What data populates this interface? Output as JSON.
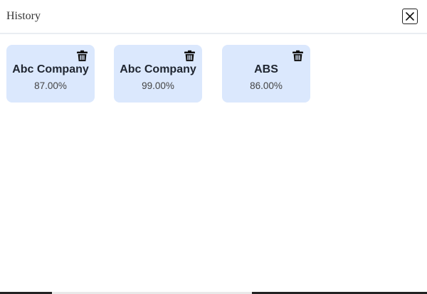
{
  "header": {
    "title": "History"
  },
  "history": {
    "items": [
      {
        "name": "Abc Company",
        "score": "87.00%"
      },
      {
        "name": "Abc Company",
        "score": "99.00%"
      },
      {
        "name": "ABS",
        "score": "86.00%"
      }
    ]
  },
  "icons": {
    "close": "close-icon",
    "delete": "trash-icon"
  },
  "colors": {
    "card_background": "#dbe8fd",
    "header_divider": "#e9edf2",
    "icon": "#111111"
  }
}
